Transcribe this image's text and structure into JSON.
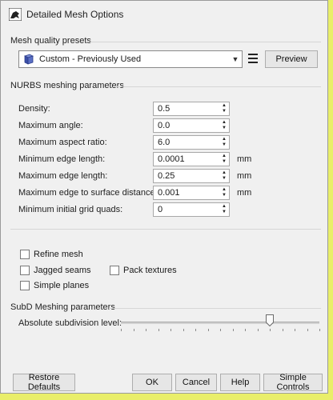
{
  "window": {
    "title": "Detailed Mesh Options"
  },
  "presets": {
    "group_label": "Mesh quality presets",
    "selected": "Custom - Previously Used",
    "preview_label": "Preview"
  },
  "nurbs": {
    "group_label": "NURBS meshing parameters",
    "rows": [
      {
        "label": "Density:",
        "value": "0.5",
        "unit": ""
      },
      {
        "label": "Maximum angle:",
        "value": "0.0",
        "unit": ""
      },
      {
        "label": "Maximum aspect ratio:",
        "value": "6.0",
        "unit": ""
      },
      {
        "label": "Minimum edge length:",
        "value": "0.0001",
        "unit": "mm"
      },
      {
        "label": "Maximum edge length:",
        "value": "0.25",
        "unit": "mm"
      },
      {
        "label": "Maximum edge to surface distance:",
        "value": "0.001",
        "unit": "mm"
      },
      {
        "label": "Minimum initial grid quads:",
        "value": "0",
        "unit": ""
      }
    ]
  },
  "options": {
    "refine_mesh": "Refine mesh",
    "jagged_seams": "Jagged seams",
    "pack_textures": "Pack textures",
    "simple_planes": "Simple planes"
  },
  "subd": {
    "group_label": "SubD Meshing parameters",
    "level_label": "Absolute subdivision level:",
    "level_fraction": 0.75
  },
  "footer": {
    "restore_defaults": "Restore Defaults",
    "ok": "OK",
    "cancel": "Cancel",
    "help": "Help",
    "simple_controls": "Simple Controls"
  }
}
